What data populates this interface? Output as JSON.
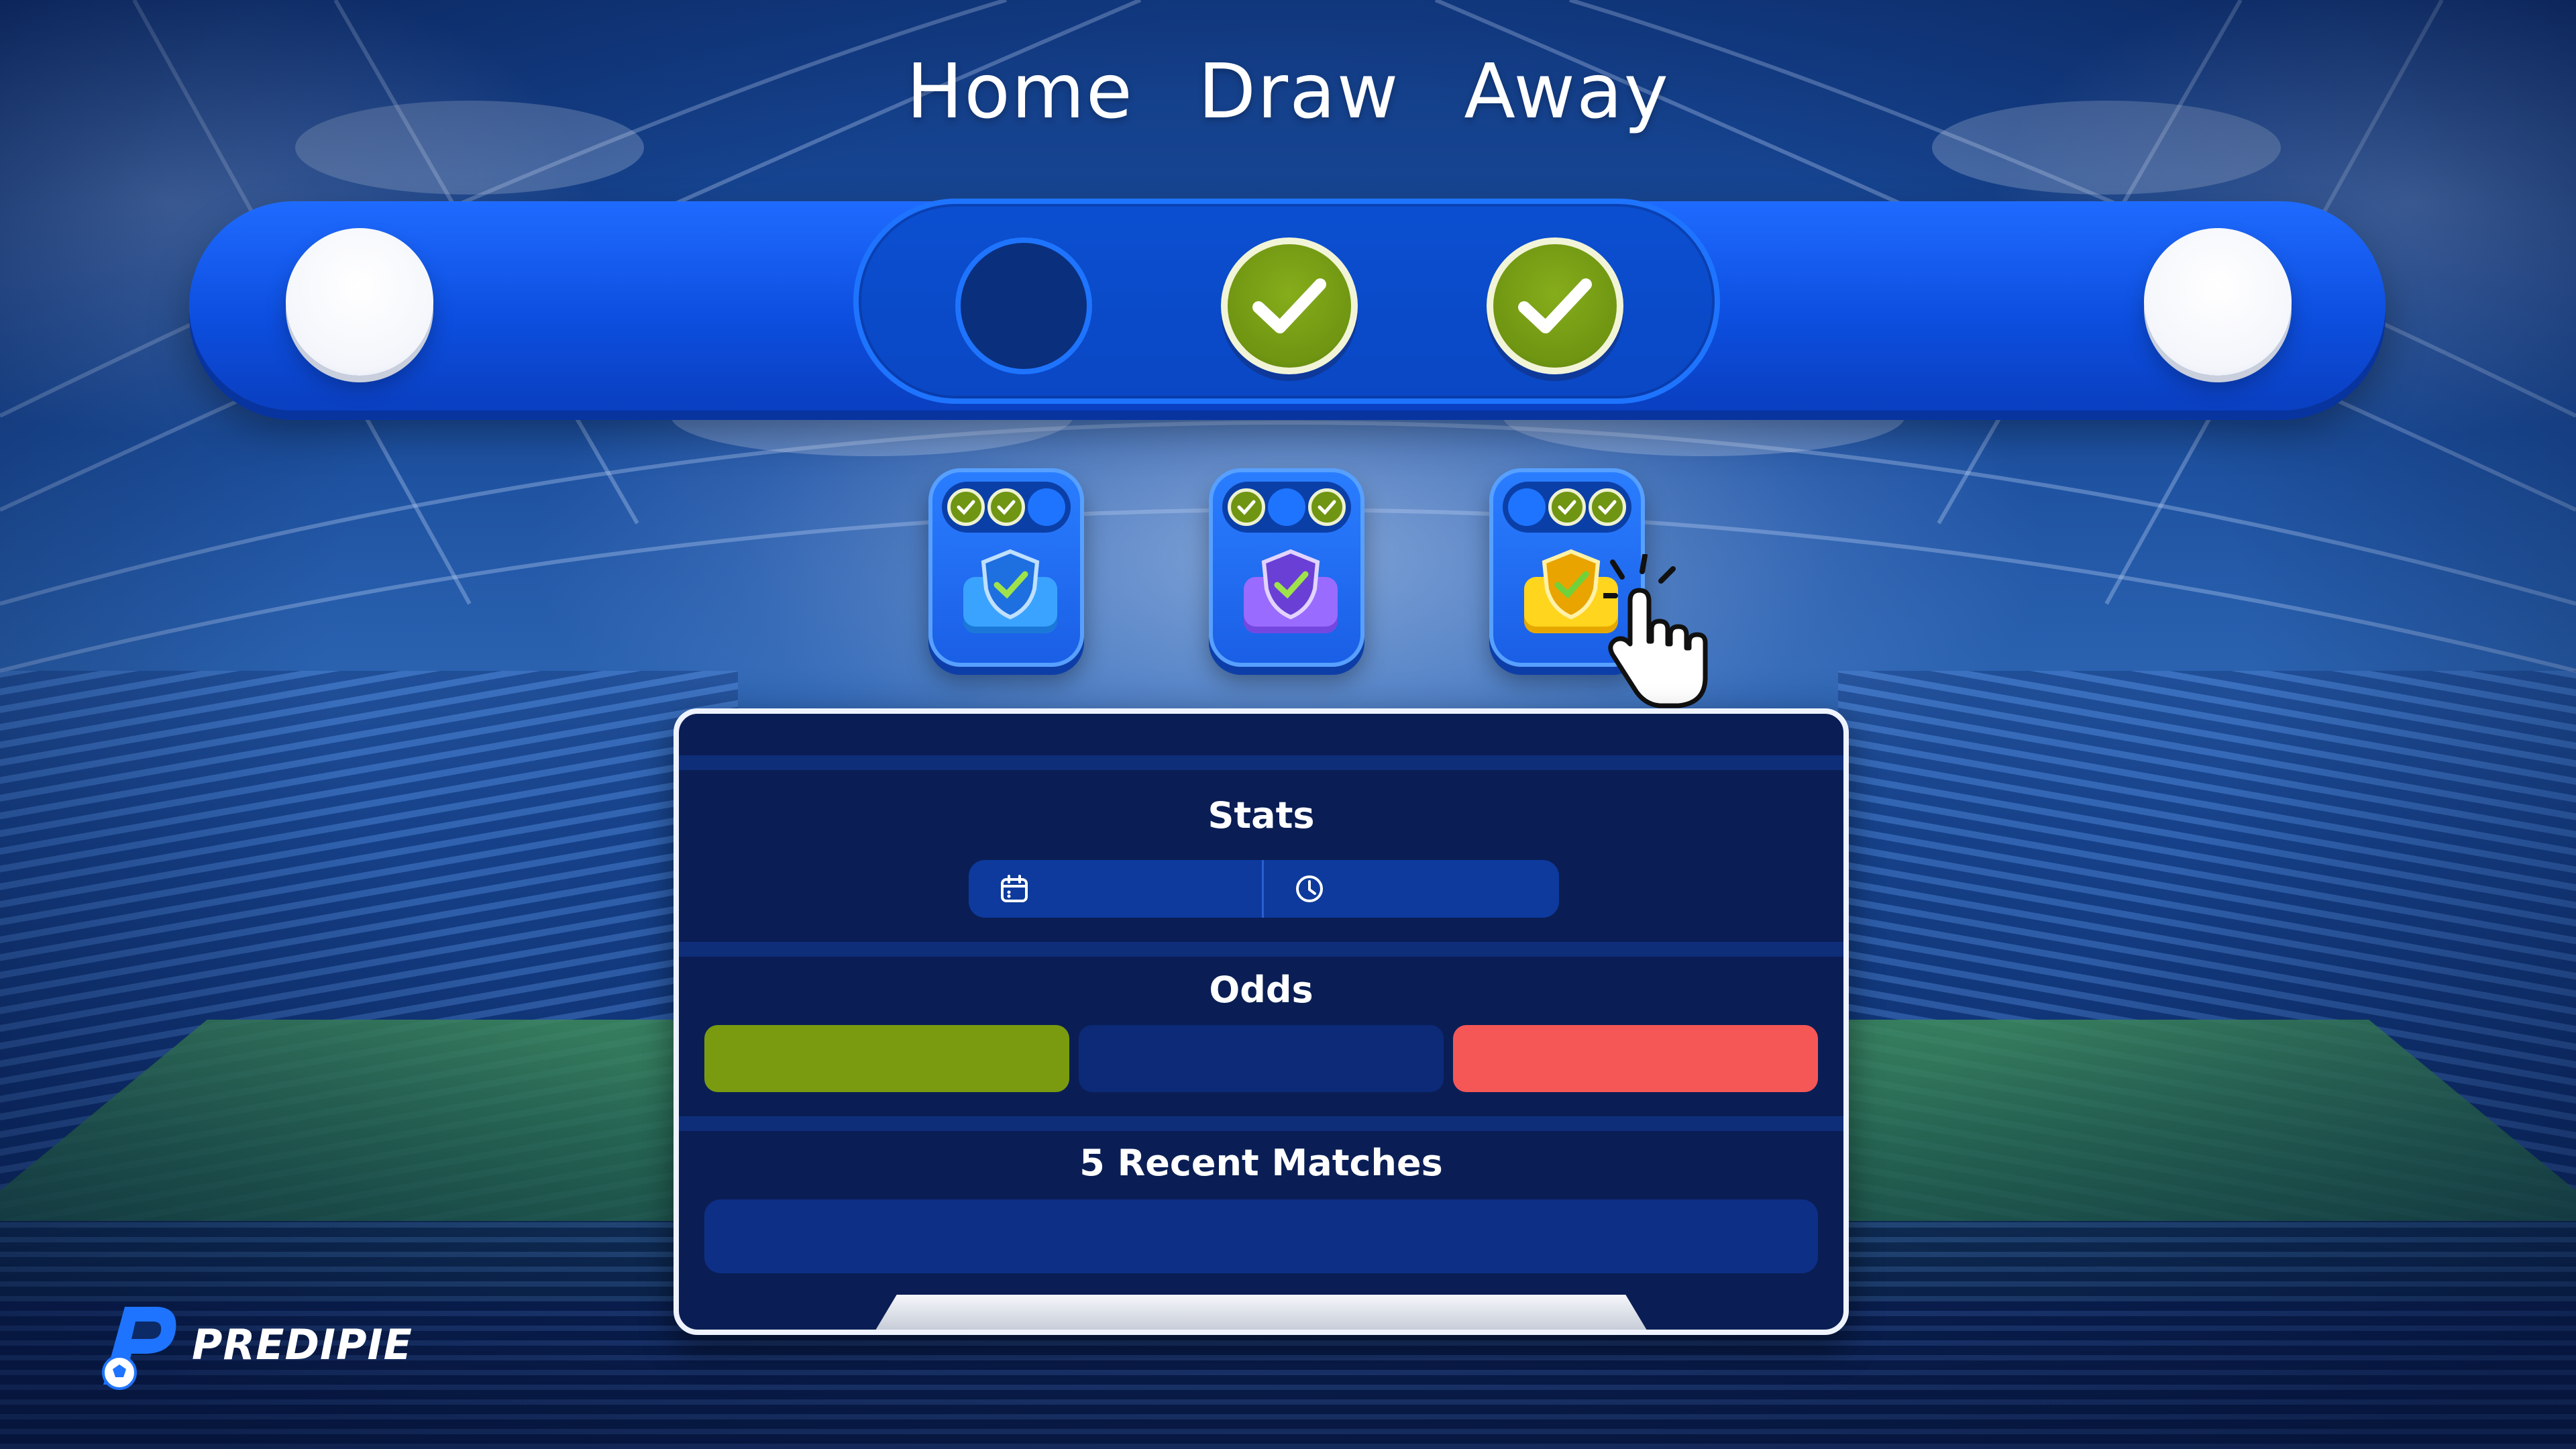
{
  "header": {
    "labels": [
      "Home",
      "Draw",
      "Away"
    ]
  },
  "selector": {
    "outcomes": [
      {
        "name": "Home",
        "checked": false
      },
      {
        "name": "Draw",
        "checked": true
      },
      {
        "name": "Away",
        "checked": true
      }
    ]
  },
  "modes": [
    {
      "badge_color": "#3aa3ff",
      "indicators": [
        true,
        true,
        false
      ]
    },
    {
      "badge_color": "#9a6bff",
      "indicators": [
        true,
        false,
        true
      ]
    },
    {
      "badge_color": "#ffd51e",
      "indicators": [
        false,
        true,
        true
      ],
      "selected": true
    }
  ],
  "panel": {
    "stats_title": "Stats",
    "stats_icons": [
      "calendar-icon",
      "clock-icon"
    ],
    "odds_title": "Odds",
    "odds_colors": {
      "home": "#7a9b0f",
      "draw": "#0c2a78",
      "away": "#f55756"
    },
    "recent_title": "5 Recent Matches"
  },
  "brand": {
    "name": "PREDIPIE",
    "accent": "#1e74ff"
  }
}
